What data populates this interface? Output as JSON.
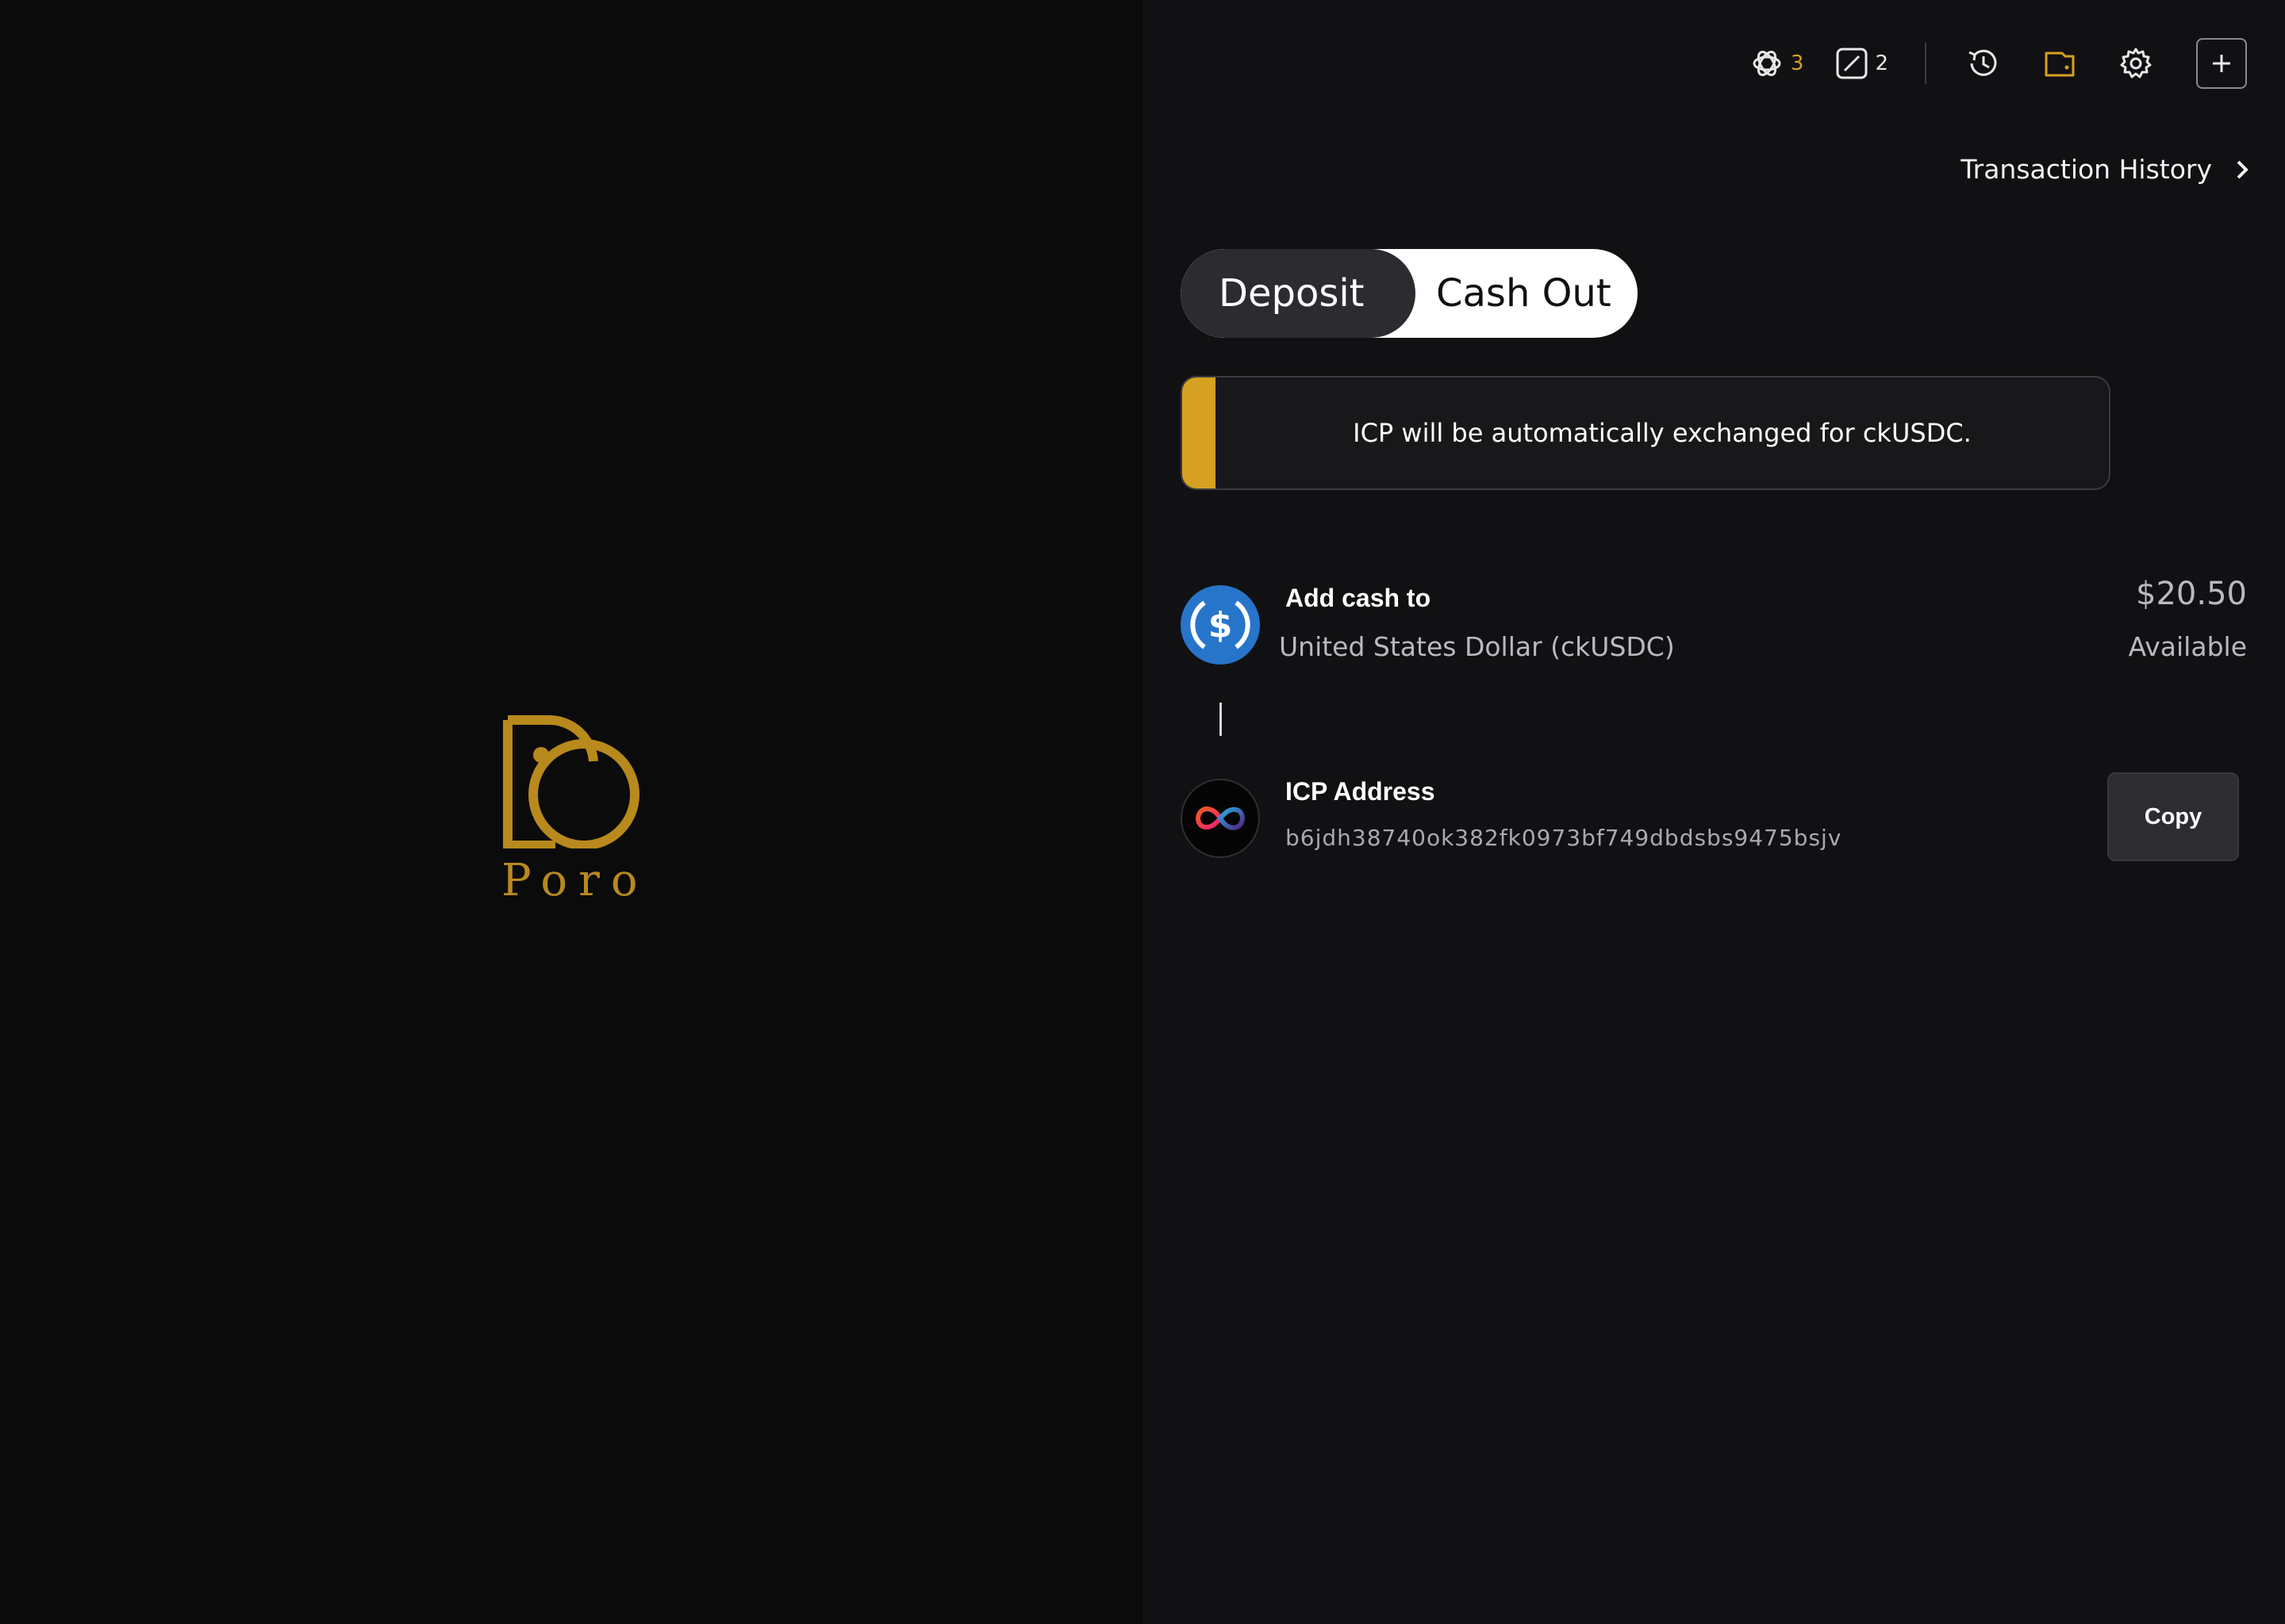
{
  "brand": {
    "name": "Poro",
    "color": "#b8891c"
  },
  "toolbar": {
    "credits_a": {
      "icon": "openai-icon",
      "count": "3",
      "color": "#d6a021"
    },
    "credits_b": {
      "icon": "edit-square-icon",
      "count": "2"
    },
    "icons": [
      "history-icon",
      "wallet-icon",
      "gear-icon",
      "plus-icon"
    ]
  },
  "transaction_history": {
    "label": "Transaction History"
  },
  "tabs": {
    "deposit": "Deposit",
    "cash_out": "Cash Out",
    "active": "Deposit"
  },
  "notice": {
    "text": "ICP will be automatically exchanged for ckUSDC.",
    "accent": "#d6a021"
  },
  "add_cash": {
    "title": "Add cash to",
    "currency": "United States Dollar (ckUSDC)",
    "balance": "$20.50",
    "balance_label": "Available",
    "coin_icon": "usdc-coin-icon",
    "coin_color": "#2775ca"
  },
  "icp": {
    "title": "ICP Address",
    "address": "b6jdh38740ok382fk0973bf749dbdsbs9475bsjv",
    "coin_icon": "icp-infinity-icon",
    "copy_label": "Copy"
  }
}
